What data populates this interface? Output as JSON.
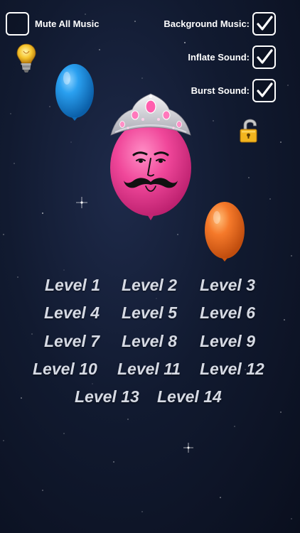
{
  "settings": {
    "mute_all_music": {
      "label": "Mute All Music",
      "checked": false
    },
    "background_music": {
      "label": "Background Music:",
      "checked": true
    },
    "inflate_sound": {
      "label": "Inflate Sound:",
      "checked": true
    },
    "burst_sound": {
      "label": "Burst Sound:",
      "checked": true
    }
  },
  "icons": {
    "hint": "lightbulb-icon",
    "lock": "unlocked-padlock-icon"
  },
  "balloons": {
    "blue": {
      "color": "#1f8fe0"
    },
    "pink": {
      "color": "#f0479a"
    },
    "orange": {
      "color": "#f5792a"
    }
  },
  "levels": [
    [
      "Level 1",
      "Level 2",
      "Level 3"
    ],
    [
      "Level 4",
      "Level 5",
      "Level 6"
    ],
    [
      "Level 7",
      "Level 8",
      "Level 9"
    ],
    [
      "Level 10",
      "Level 11",
      "Level 12"
    ],
    [
      "Level 13",
      "Level 14"
    ]
  ]
}
